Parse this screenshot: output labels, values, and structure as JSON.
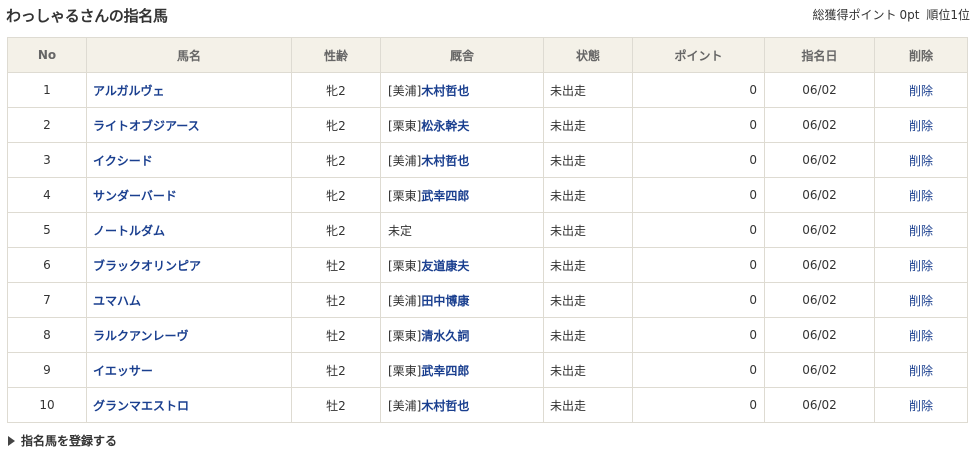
{
  "title": "わっしゃるさんの指名馬",
  "stats": {
    "points_label": "総獲得ポイント",
    "points_value": "0pt",
    "rank_label": "順位",
    "rank_value": "1位"
  },
  "columns": [
    "No",
    "馬名",
    "性齢",
    "厩舎",
    "状態",
    "ポイント",
    "指名日",
    "削除"
  ],
  "rows": [
    {
      "no": "1",
      "name": "アルガルヴェ",
      "sex_age": "牝2",
      "region": "[美浦]",
      "trainer": "木村哲也",
      "state": "未出走",
      "point": "0",
      "date": "06/02",
      "delete": "削除"
    },
    {
      "no": "2",
      "name": "ライトオブジアース",
      "sex_age": "牝2",
      "region": "[栗東]",
      "trainer": "松永幹夫",
      "state": "未出走",
      "point": "0",
      "date": "06/02",
      "delete": "削除"
    },
    {
      "no": "3",
      "name": "イクシード",
      "sex_age": "牝2",
      "region": "[美浦]",
      "trainer": "木村哲也",
      "state": "未出走",
      "point": "0",
      "date": "06/02",
      "delete": "削除"
    },
    {
      "no": "4",
      "name": "サンダーバード",
      "sex_age": "牝2",
      "region": "[栗東]",
      "trainer": "武幸四郎",
      "state": "未出走",
      "point": "0",
      "date": "06/02",
      "delete": "削除"
    },
    {
      "no": "5",
      "name": "ノートルダム",
      "sex_age": "牝2",
      "region": "",
      "trainer": "",
      "stable_text": "未定",
      "state": "未出走",
      "point": "0",
      "date": "06/02",
      "delete": "削除"
    },
    {
      "no": "6",
      "name": "ブラックオリンピア",
      "sex_age": "牡2",
      "region": "[栗東]",
      "trainer": "友道康夫",
      "state": "未出走",
      "point": "0",
      "date": "06/02",
      "delete": "削除"
    },
    {
      "no": "7",
      "name": "ユマハム",
      "sex_age": "牡2",
      "region": "[美浦]",
      "trainer": "田中博康",
      "state": "未出走",
      "point": "0",
      "date": "06/02",
      "delete": "削除"
    },
    {
      "no": "8",
      "name": "ラルクアンレーヴ",
      "sex_age": "牡2",
      "region": "[栗東]",
      "trainer": "清水久詞",
      "state": "未出走",
      "point": "0",
      "date": "06/02",
      "delete": "削除"
    },
    {
      "no": "9",
      "name": "イエッサー",
      "sex_age": "牡2",
      "region": "[栗東]",
      "trainer": "武幸四郎",
      "state": "未出走",
      "point": "0",
      "date": "06/02",
      "delete": "削除"
    },
    {
      "no": "10",
      "name": "グランマエストロ",
      "sex_age": "牡2",
      "region": "[美浦]",
      "trainer": "木村哲也",
      "state": "未出走",
      "point": "0",
      "date": "06/02",
      "delete": "削除"
    }
  ],
  "register_label": "指名馬を登録する",
  "colors": {
    "link": "#1a3f8f",
    "header_bg": "#f4f1e8",
    "border": "#dedbd2"
  },
  "icons": {
    "register": "triangle-right-icon"
  }
}
